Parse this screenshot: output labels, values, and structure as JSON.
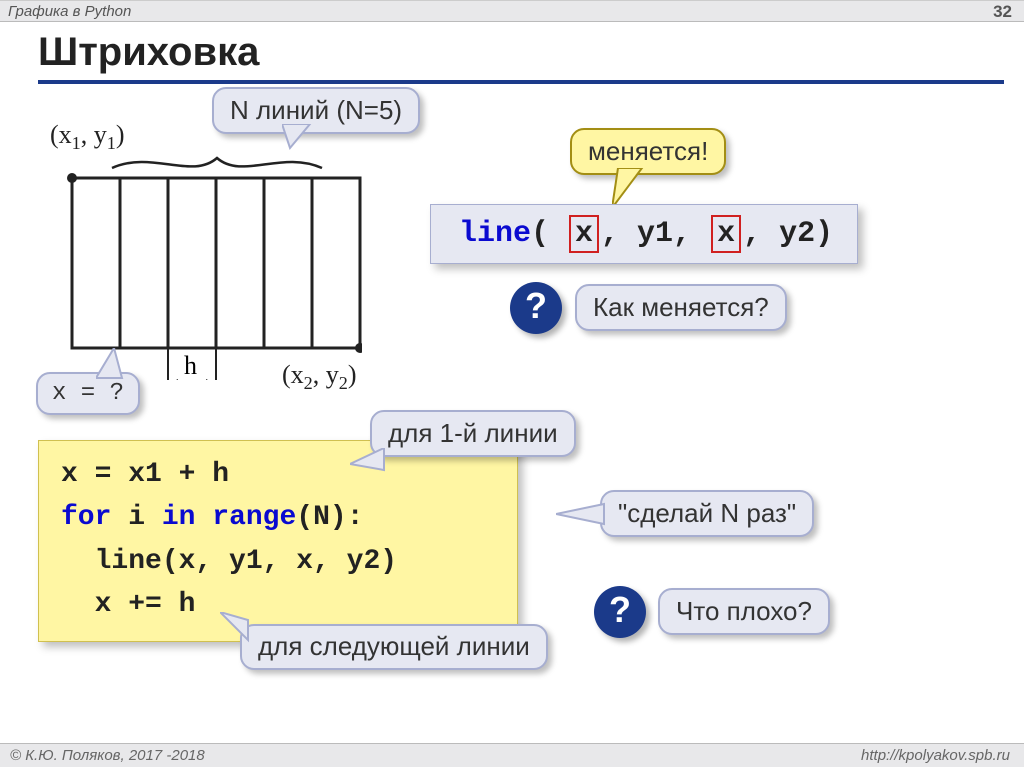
{
  "header": {
    "title": "Графика в Python",
    "page": "32"
  },
  "footer": {
    "copyright": "© К.Ю. Поляков, 2017 -2018",
    "url": "http://kpolyakov.spb.ru"
  },
  "title": "Штриховка",
  "bubbles": {
    "n_lines": "N линий (N=5)",
    "x_eq": "x = ?",
    "changes": "меняется!",
    "q_how": "Как меняется?",
    "first_line": "для 1-й линии",
    "do_n": "\"сделай N раз\"",
    "next_line": "для следующей линии",
    "q_bad": "Что плохо?"
  },
  "labels": {
    "p1_before": "(x",
    "p1_sub1": "1",
    "p1_mid": ", y",
    "p1_sub2": "1",
    "p1_after": ")",
    "p2_before": "(x",
    "p2_sub1": "2",
    "p2_mid": ", y",
    "p2_sub2": "2",
    "p2_after": ")",
    "h": "h"
  },
  "strip": {
    "fn": "line",
    "open": "( ",
    "x": "x",
    "sep1": ", y1, ",
    "sep2": ", y2)"
  },
  "code": {
    "l1_a": "x = x1 + h",
    "l2_for": "for",
    "l2_mid": " i ",
    "l2_in": "in",
    "l2_sp": " ",
    "l2_range": "range",
    "l2_tail": "(N):",
    "l3": "  line(x, y1, x, y2)",
    "l4": "  x += h"
  },
  "q": "?"
}
